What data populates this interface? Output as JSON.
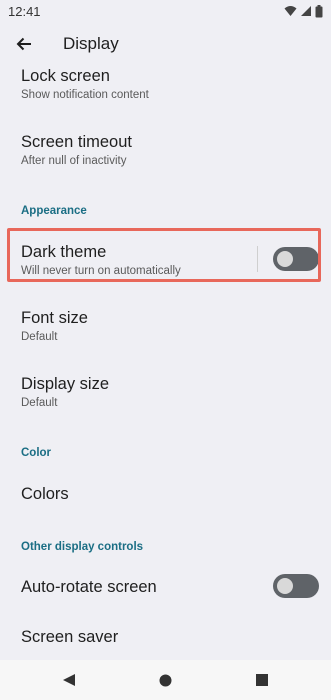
{
  "status_bar": {
    "time": "12:41",
    "icons": [
      "wifi-icon",
      "signal-icon",
      "battery-icon"
    ]
  },
  "app_bar": {
    "back_icon": "arrow-left-icon",
    "title": "Display"
  },
  "settings": {
    "lock_screen": {
      "title": "Lock screen",
      "summary": "Show notification content"
    },
    "screen_timeout": {
      "title": "Screen timeout",
      "summary": "After null of inactivity"
    },
    "appearance_header": "Appearance",
    "dark_theme": {
      "title": "Dark theme",
      "summary": "Will never turn on automatically",
      "enabled": false
    },
    "font_size": {
      "title": "Font size",
      "summary": "Default"
    },
    "display_size": {
      "title": "Display size",
      "summary": "Default"
    },
    "color_header": "Color",
    "colors": {
      "title": "Colors"
    },
    "other_header": "Other display controls",
    "auto_rotate": {
      "title": "Auto-rotate screen",
      "enabled": false
    },
    "screen_saver": {
      "title": "Screen saver"
    }
  },
  "nav_bar": {
    "back_icon": "triangle-back-icon",
    "home_icon": "circle-home-icon",
    "recents_icon": "square-recents-icon"
  },
  "colors": {
    "background": "#efeff4",
    "accent": "#1b6e84",
    "highlight": "#e8675a",
    "toggle_track": "#5f6368"
  }
}
